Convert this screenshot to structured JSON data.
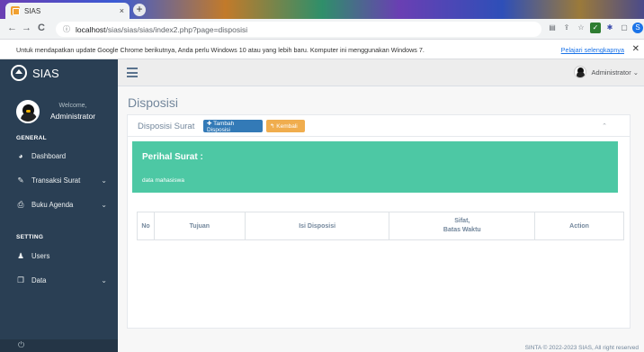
{
  "browser": {
    "tab_title": "SIAS",
    "tab_close": "×",
    "new_tab": "+",
    "url_host": "localhost",
    "url_path": "/sias/sias/sias/index2.php?page=disposisi",
    "back": "←",
    "forward": "→",
    "reload": "C",
    "info": "ⓘ",
    "infobar_text": "Untuk mendapatkan update Google Chrome berikutnya, Anda perlu Windows 10 atau yang lebih baru. Komputer ini menggunakan Windows 7.",
    "infobar_link": "Pelajari selengkapnya",
    "infobar_close": "✕"
  },
  "sidebar": {
    "brand": "SIAS",
    "welcome": "Welcome,",
    "username": "Administrator",
    "section_general": "GENERAL",
    "section_setting": "SETTING",
    "items": [
      {
        "label": "Dashboard",
        "icon": "tachometer-icon",
        "glyph": "◕"
      },
      {
        "label": "Transaksi Surat",
        "icon": "edit-icon",
        "glyph": "✎",
        "chevron": "⌄"
      },
      {
        "label": "Buku Agenda",
        "icon": "print-icon",
        "glyph": "⎙",
        "chevron": "⌄"
      },
      {
        "label": "Users",
        "icon": "user-icon",
        "glyph": "♟"
      },
      {
        "label": "Data",
        "icon": "copy-icon",
        "glyph": "❐",
        "chevron": "⌄"
      }
    ],
    "footer_icon": "⏻"
  },
  "topnav": {
    "user": "Administrator",
    "caret": "⌄"
  },
  "main": {
    "page_title": "Disposisi",
    "panel_title": "Disposisi Surat",
    "add_button": "✚ Tambah Disposisi",
    "back_button": "↰ Kembali",
    "collapse": "⌃",
    "alert_title": "Perihal Surat :",
    "alert_body": "data mahasiswa",
    "table_headers": {
      "no": "No",
      "tujuan": "Tujuan",
      "isi": "Isi Disposisi",
      "sifat_line1": "Sifat,",
      "sifat_line2": "Batas Waktu",
      "action": "Action"
    },
    "copyright": "SINTA © 2022-2023 SIAS, All right reserved"
  },
  "colors": {
    "sidebar": "#2a3f54",
    "alert": "#4dc8a4",
    "primary_button": "#337ab7",
    "warning_button": "#f0ad4e"
  }
}
